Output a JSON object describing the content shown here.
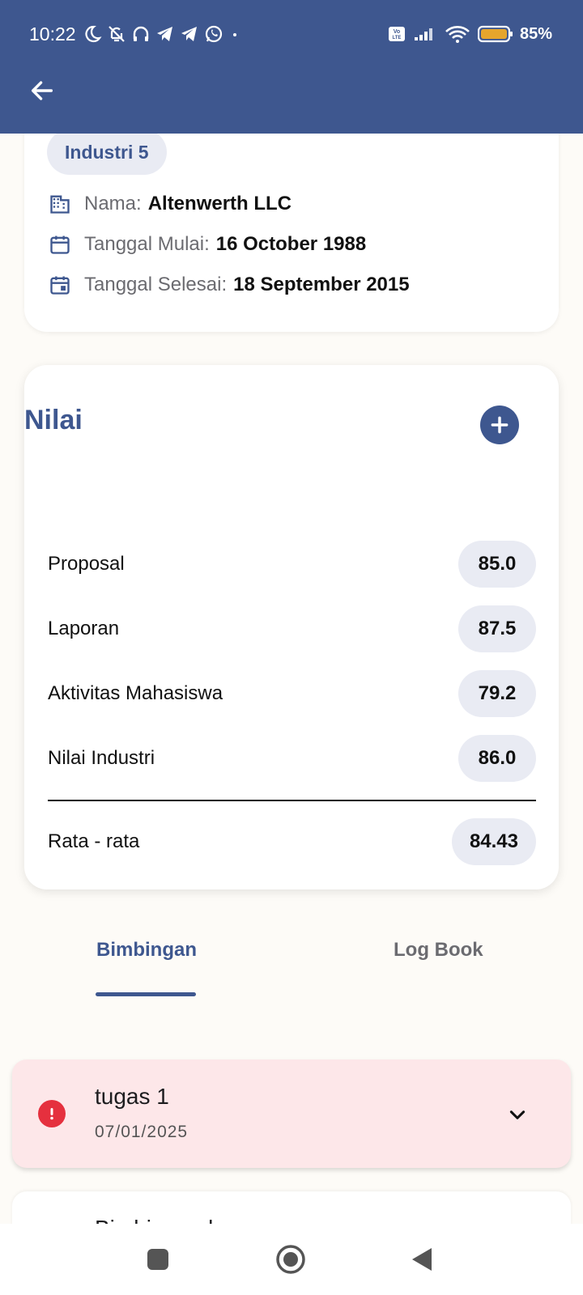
{
  "status_bar": {
    "time": "10:22",
    "battery": "85%",
    "icons_left": [
      "moon-icon",
      "bell-off-icon",
      "headset-icon",
      "telegram-icon",
      "telegram-icon",
      "whatsapp-icon",
      "dot-icon"
    ],
    "icons_right": [
      "volte-icon",
      "signal-icon",
      "wifi-icon",
      "battery-icon"
    ]
  },
  "app_bar": {
    "back_icon": "arrow-left-icon",
    "color": "#3e578f"
  },
  "info": {
    "chip": "Industri 5",
    "nama_label": "Nama:",
    "nama_value": "Altenwerth LLC",
    "mulai_label": "Tanggal Mulai:",
    "mulai_value": "16 October 1988",
    "selesai_label": "Tanggal Selesai:",
    "selesai_value": "18 September 2015"
  },
  "nilai": {
    "title": "Nilai",
    "add_icon": "plus-circle-icon",
    "rows": [
      {
        "label": "Proposal",
        "value": "85.0"
      },
      {
        "label": "Laporan",
        "value": "87.5"
      },
      {
        "label": "Aktivitas Mahasiswa",
        "value": "79.2"
      },
      {
        "label": "Nilai Industri",
        "value": "86.0"
      }
    ],
    "average": {
      "label": "Rata - rata",
      "value": "84.43"
    }
  },
  "tabs": [
    {
      "label": "Bimbingan",
      "active": true
    },
    {
      "label": "Log Book",
      "active": false
    }
  ],
  "tugas": {
    "title": "tugas 1",
    "date": "07/01/2025",
    "status_color": "#e5303e"
  },
  "next_item": {
    "title": "Bimbingan ke"
  },
  "nav": [
    "recents-icon",
    "home-icon",
    "back-icon"
  ]
}
